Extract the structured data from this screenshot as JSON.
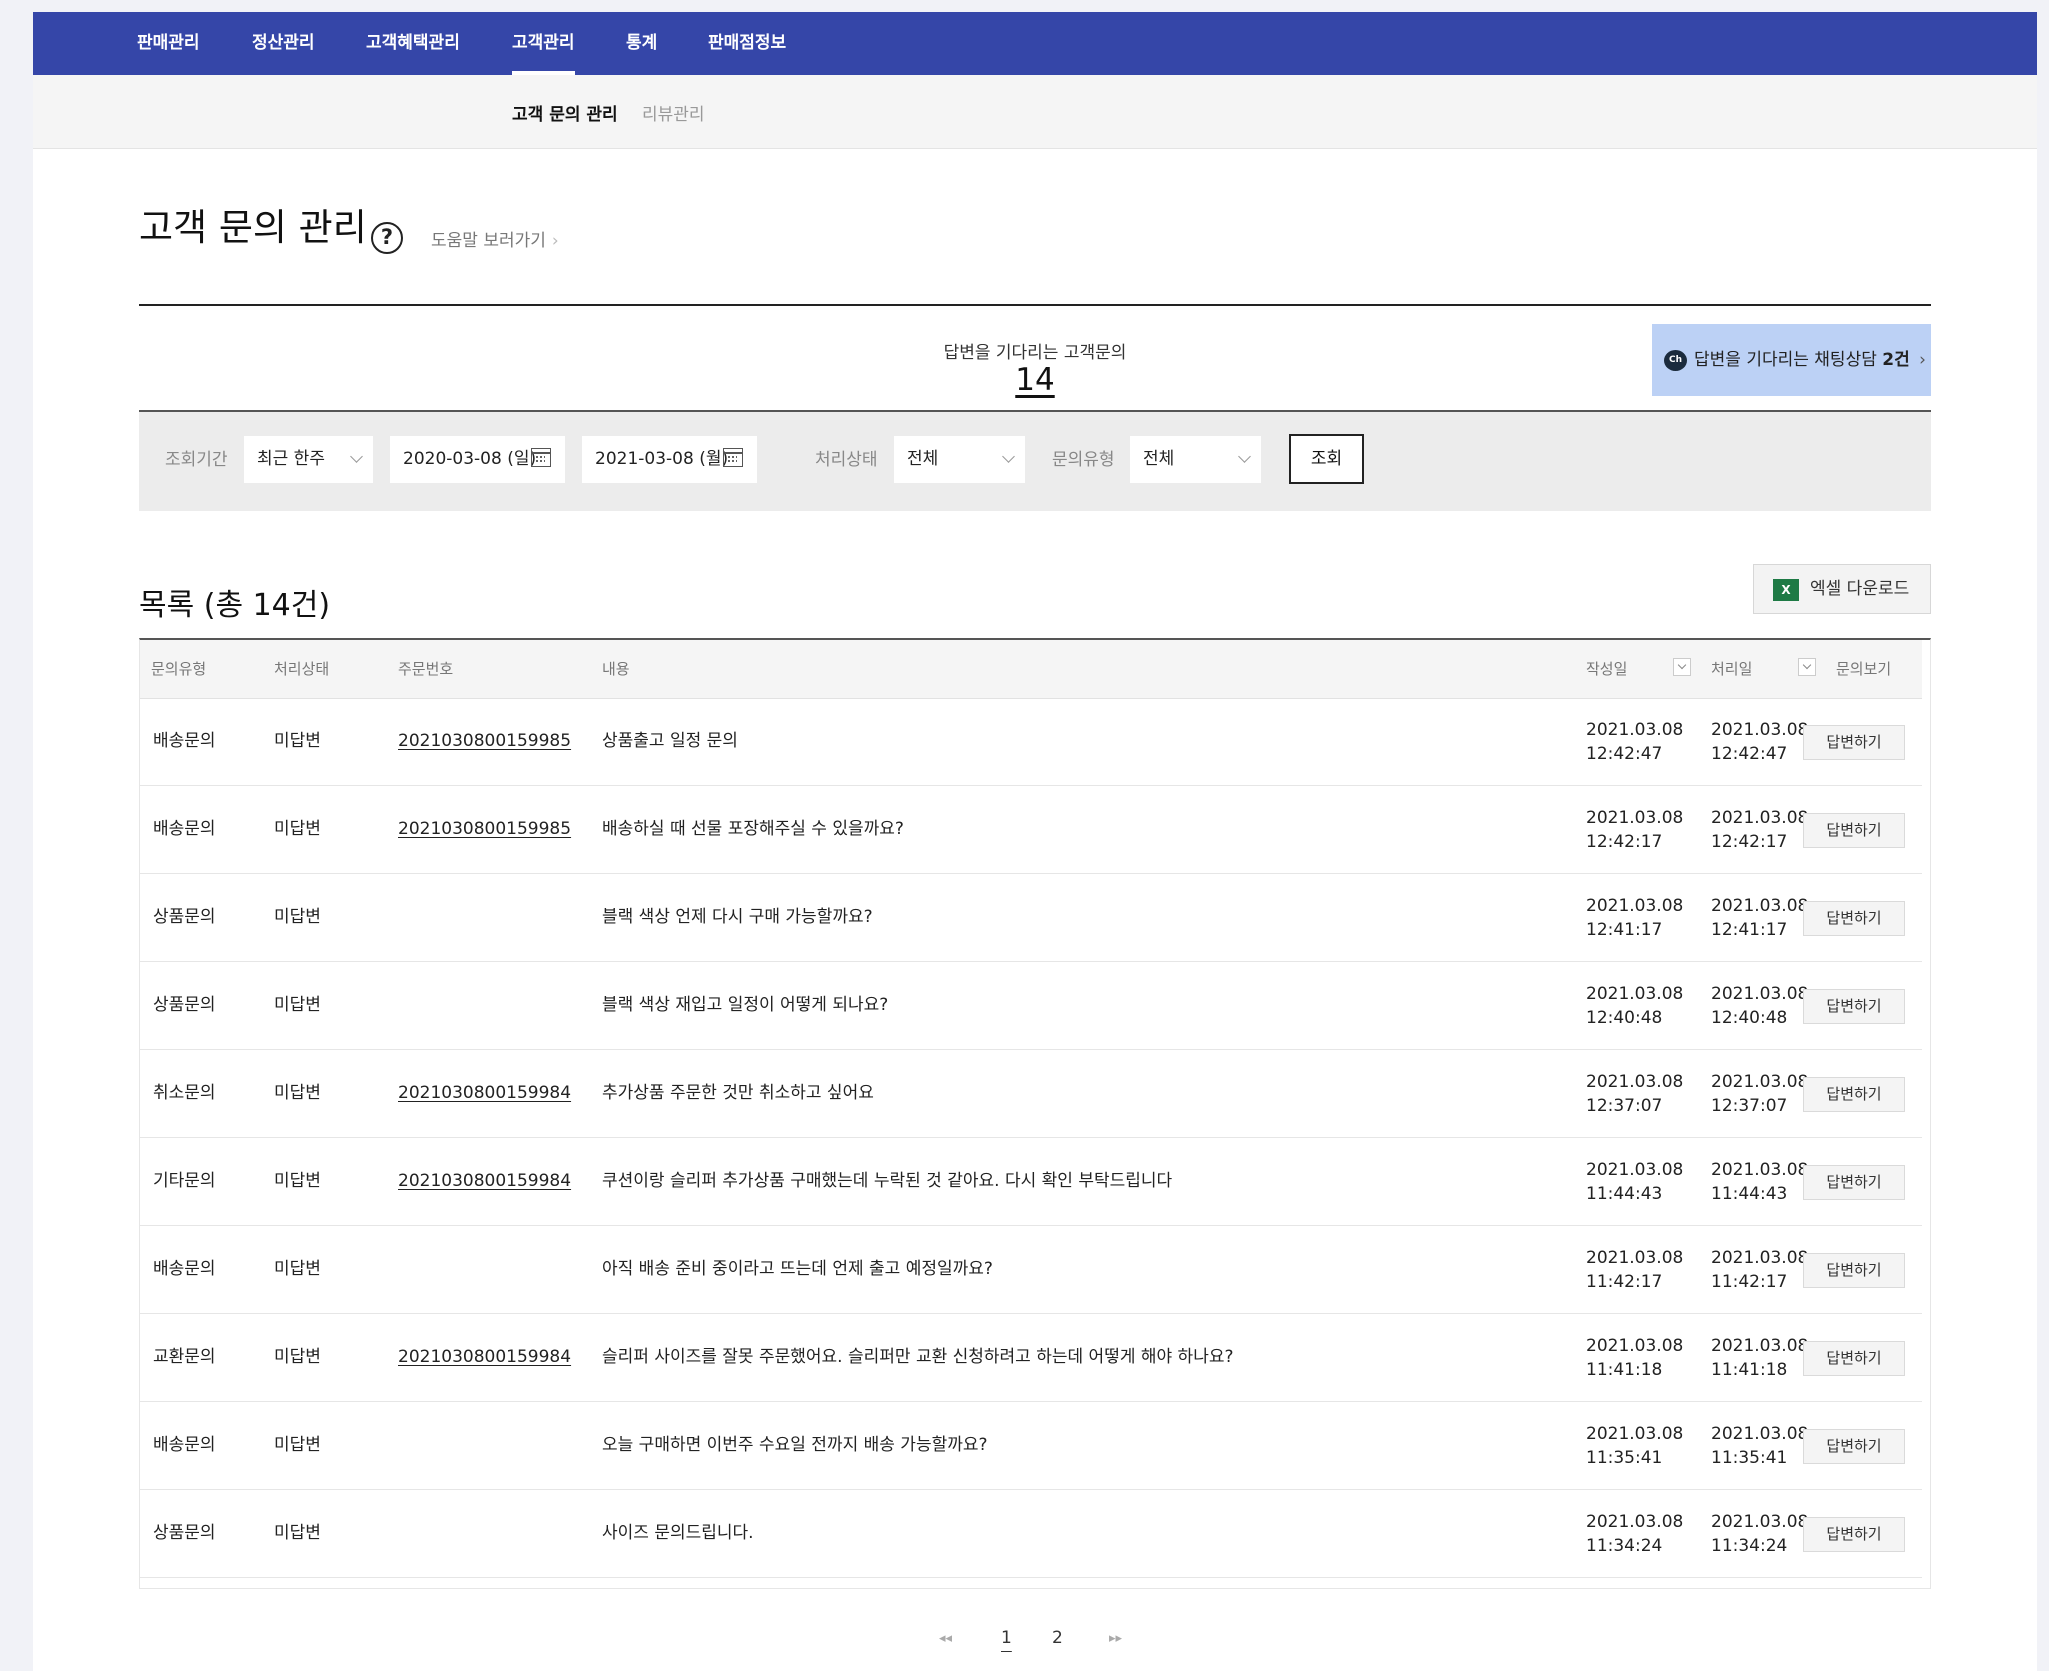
{
  "nav": {
    "items": [
      "판매관리",
      "정산관리",
      "고객혜택관리",
      "고객관리",
      "통계",
      "판매점정보"
    ],
    "active": "고객관리"
  },
  "subnav": {
    "items": [
      "고객 문의 관리",
      "리뷰관리"
    ],
    "active": "고객 문의 관리"
  },
  "page": {
    "title": "고객 문의 관리",
    "help_symbol": "?",
    "help_link": "도움말 보러가기",
    "help_chevron": "›"
  },
  "summary": {
    "waiting_label": "답변을 기다리는 고객문의",
    "waiting_count": "14",
    "chat_icon_text": "Ch",
    "chat_label": "답변을 기다리는 채팅상담",
    "chat_count": "2건",
    "chat_chevron": "›"
  },
  "filter": {
    "period_label": "조회기간",
    "period_value": "최근 한주",
    "start_date": "2020-03-08 (일)",
    "date_separator": "-",
    "end_date": "2021-03-08 (월)",
    "status_label": "처리상태",
    "status_value": "전체",
    "type_label": "문의유형",
    "type_value": "전체",
    "search_button": "조회"
  },
  "list": {
    "title": "목록 (총 14건)",
    "excel_icon_text": "X",
    "excel_button": "엑셀 다운로드",
    "columns": [
      "문의유형",
      "처리상태",
      "주문번호",
      "내용",
      "작성일",
      "처리일",
      "문의보기"
    ],
    "answer_button": "답변하기",
    "rows": [
      {
        "type": "배송문의",
        "status": "미답변",
        "order": "2021030800159985",
        "content": "상품출고 일정 문의",
        "created_date": "2021.03.08",
        "created_time": "12:42:47",
        "processed_date": "2021.03.08",
        "processed_time": "12:42:47"
      },
      {
        "type": "배송문의",
        "status": "미답변",
        "order": "2021030800159985",
        "content": "배송하실 때 선물 포장해주실 수 있을까요?",
        "created_date": "2021.03.08",
        "created_time": "12:42:17",
        "processed_date": "2021.03.08",
        "processed_time": "12:42:17"
      },
      {
        "type": "상품문의",
        "status": "미답변",
        "order": "",
        "content": "블랙 색상 언제 다시 구매 가능할까요?",
        "created_date": "2021.03.08",
        "created_time": "12:41:17",
        "processed_date": "2021.03.08",
        "processed_time": "12:41:17"
      },
      {
        "type": "상품문의",
        "status": "미답변",
        "order": "",
        "content": "블랙 색상 재입고 일정이 어떻게 되나요?",
        "created_date": "2021.03.08",
        "created_time": "12:40:48",
        "processed_date": "2021.03.08",
        "processed_time": "12:40:48"
      },
      {
        "type": "취소문의",
        "status": "미답변",
        "order": "2021030800159984",
        "content": "추가상품 주문한 것만 취소하고 싶어요",
        "created_date": "2021.03.08",
        "created_time": "12:37:07",
        "processed_date": "2021.03.08",
        "processed_time": "12:37:07"
      },
      {
        "type": "기타문의",
        "status": "미답변",
        "order": "2021030800159984",
        "content": "쿠션이랑 슬리퍼 추가상품 구매했는데 누락된 것 같아요. 다시 확인 부탁드립니다",
        "created_date": "2021.03.08",
        "created_time": "11:44:43",
        "processed_date": "2021.03.08",
        "processed_time": "11:44:43"
      },
      {
        "type": "배송문의",
        "status": "미답변",
        "order": "",
        "content": "아직 배송 준비 중이라고 뜨는데 언제 출고 예정일까요?",
        "created_date": "2021.03.08",
        "created_time": "11:42:17",
        "processed_date": "2021.03.08",
        "processed_time": "11:42:17"
      },
      {
        "type": "교환문의",
        "status": "미답변",
        "order": "2021030800159984",
        "content": "슬리퍼 사이즈를 잘못 주문했어요. 슬리퍼만 교환 신청하려고 하는데 어떻게 해야 하나요?",
        "created_date": "2021.03.08",
        "created_time": "11:41:18",
        "processed_date": "2021.03.08",
        "processed_time": "11:41:18"
      },
      {
        "type": "배송문의",
        "status": "미답변",
        "order": "",
        "content": "오늘 구매하면 이번주 수요일 전까지 배송 가능할까요?",
        "created_date": "2021.03.08",
        "created_time": "11:35:41",
        "processed_date": "2021.03.08",
        "processed_time": "11:35:41"
      },
      {
        "type": "상품문의",
        "status": "미답변",
        "order": "",
        "content": "사이즈 문의드립니다.",
        "created_date": "2021.03.08",
        "created_time": "11:34:24",
        "processed_date": "2021.03.08",
        "processed_time": "11:34:24"
      }
    ]
  },
  "pagination": {
    "first": "◂◂",
    "pages": [
      "1",
      "2"
    ],
    "current": "1",
    "last": "▸▸"
  }
}
